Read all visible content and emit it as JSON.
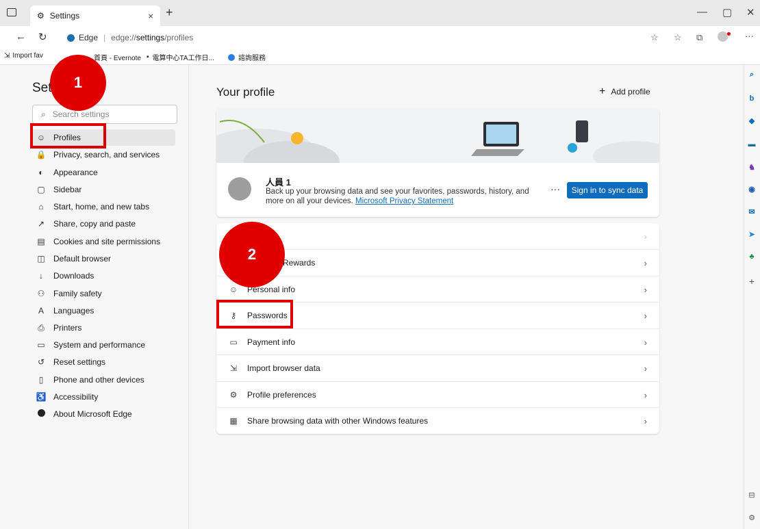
{
  "browser": {
    "tab_title": "Settings",
    "address_prefix": "Edge",
    "address_url_plain": "edge://",
    "address_url_bold": "settings",
    "address_url_rest": "/profiles"
  },
  "favorites": [
    {
      "label": "Import fav"
    },
    {
      "label": "首頁 - Evernote"
    },
    {
      "label": "電算中心TA工作日..."
    },
    {
      "label": "諮詢服務"
    }
  ],
  "sidebar": {
    "title": "Settings",
    "search_placeholder": "Search settings",
    "items": [
      {
        "label": "Profiles",
        "icon": "profile-icon",
        "glyph": "☺"
      },
      {
        "label": "Privacy, search, and services",
        "icon": "lock-icon",
        "glyph": "🔒"
      },
      {
        "label": "Appearance",
        "icon": "appearance-icon",
        "glyph": "◐"
      },
      {
        "label": "Sidebar",
        "icon": "sidebar-icon",
        "glyph": "▢"
      },
      {
        "label": "Start, home, and new tabs",
        "icon": "home-icon",
        "glyph": "⌂"
      },
      {
        "label": "Share, copy and paste",
        "icon": "share-icon",
        "glyph": "↗"
      },
      {
        "label": "Cookies and site permissions",
        "icon": "cookies-icon",
        "glyph": "▤"
      },
      {
        "label": "Default browser",
        "icon": "browser-icon",
        "glyph": "◫"
      },
      {
        "label": "Downloads",
        "icon": "download-icon",
        "glyph": "↓"
      },
      {
        "label": "Family safety",
        "icon": "family-icon",
        "glyph": "⚇"
      },
      {
        "label": "Languages",
        "icon": "languages-icon",
        "glyph": "A"
      },
      {
        "label": "Printers",
        "icon": "printer-icon",
        "glyph": "⎙"
      },
      {
        "label": "System and performance",
        "icon": "system-icon",
        "glyph": "▭"
      },
      {
        "label": "Reset settings",
        "icon": "reset-icon",
        "glyph": "↺"
      },
      {
        "label": "Phone and other devices",
        "icon": "phone-icon",
        "glyph": "▯"
      },
      {
        "label": "Accessibility",
        "icon": "accessibility-icon",
        "glyph": "♿"
      },
      {
        "label": "About Microsoft Edge",
        "icon": "edge-icon",
        "glyph": "●"
      }
    ]
  },
  "main": {
    "heading": "Your profile",
    "add_profile": "Add profile",
    "profile": {
      "name": "人員 1",
      "description": "Back up your browsing data and see your favorites, passwords, history, and more on all your devices.",
      "privacy_link": "Microsoft Privacy Statement",
      "more": "···",
      "sign_in_button": "Sign in to sync data"
    },
    "rows": [
      {
        "label": "",
        "icon": "blank-icon",
        "glyph": ""
      },
      {
        "label": "Microsoft Rewards",
        "icon": "rewards-icon",
        "glyph": "✪"
      },
      {
        "label": "Personal info",
        "icon": "personal-info-icon",
        "glyph": "☺"
      },
      {
        "label": "Passwords",
        "icon": "key-icon",
        "glyph": "⚷"
      },
      {
        "label": "Payment info",
        "icon": "card-icon",
        "glyph": "▭"
      },
      {
        "label": "Import browser data",
        "icon": "import-icon",
        "glyph": "⇲"
      },
      {
        "label": "Profile preferences",
        "icon": "preferences-icon",
        "glyph": "⚙"
      },
      {
        "label": "Share browsing data with other Windows features",
        "icon": "windows-icon",
        "glyph": "▦"
      }
    ]
  },
  "annotations": {
    "badge1": "1",
    "badge2": "2"
  },
  "colors": {
    "accent": "#0f6cbd",
    "highlight": "#e00000"
  }
}
